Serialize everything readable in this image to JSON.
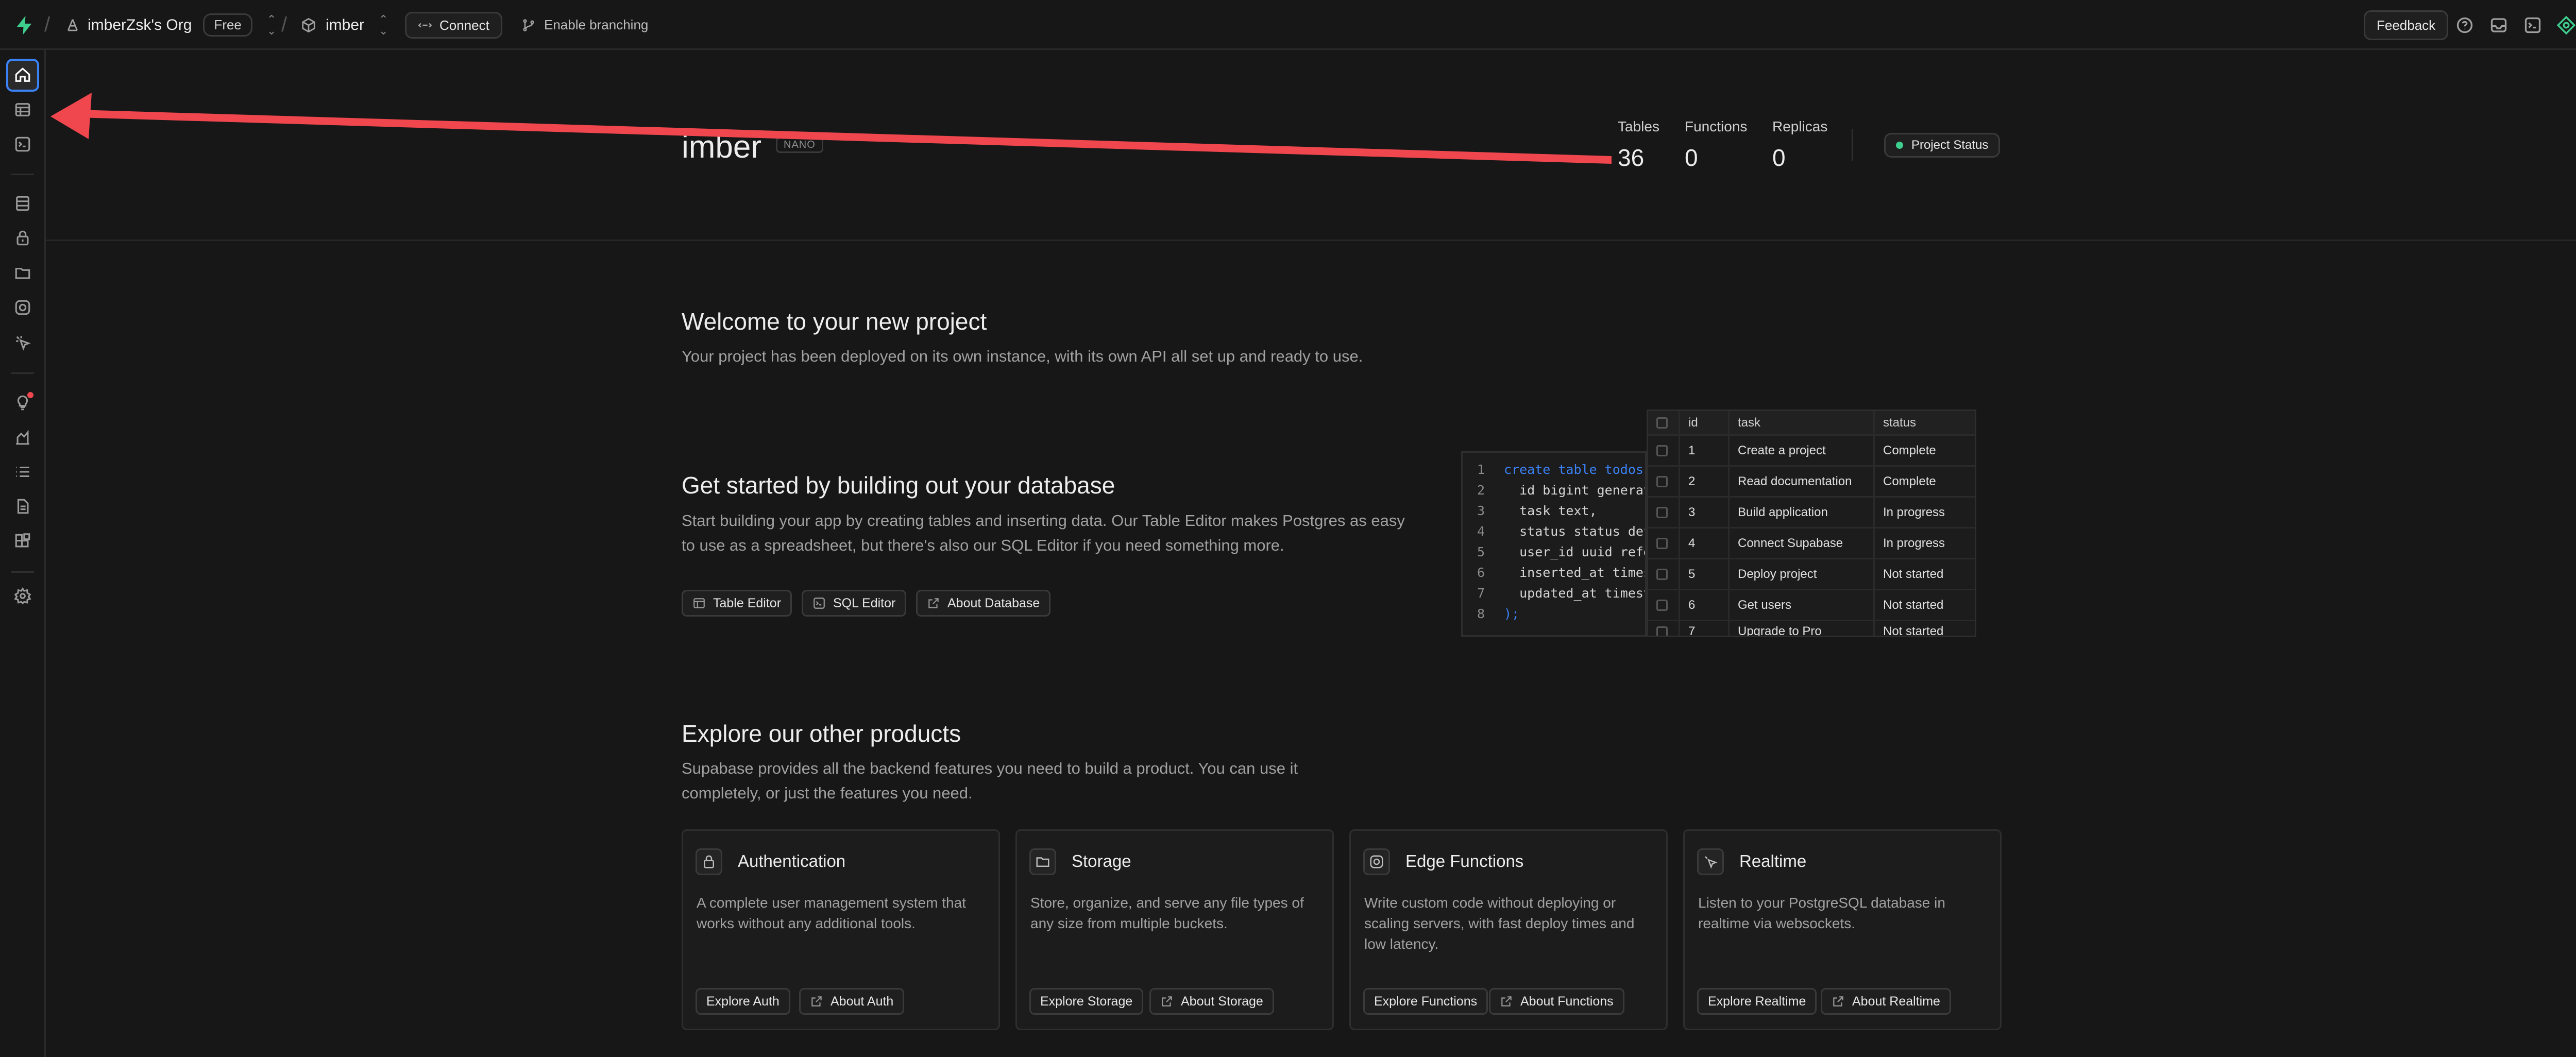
{
  "topbar": {
    "org_name": "imberZsk's Org",
    "plan_badge": "Free",
    "project_name": "imber",
    "connect_label": "Connect",
    "branching_label": "Enable branching",
    "feedback_label": "Feedback"
  },
  "project": {
    "name": "imber",
    "compute_badge": "NANO",
    "stats": [
      {
        "label": "Tables",
        "value": "36"
      },
      {
        "label": "Functions",
        "value": "0"
      },
      {
        "label": "Replicas",
        "value": "0"
      }
    ],
    "status_label": "Project Status",
    "status_color": "#3ecf8e"
  },
  "welcome": {
    "title": "Welcome to your new project",
    "text": "Your project has been deployed on its own instance, with its own API all set up and ready to use."
  },
  "database": {
    "title": "Get started by building out your database",
    "text_line1": "Start building your app by creating tables and inserting data. Our Table Editor makes Postgres as easy",
    "text_line2": "to use as a spreadsheet, but there's also our SQL Editor if you need something more.",
    "buttons": [
      "Table Editor",
      "SQL Editor",
      "About Database"
    ]
  },
  "code_sample": {
    "lines": [
      {
        "num": "1",
        "text": "create table todos"
      },
      {
        "num": "2",
        "text": "  id bigint generat"
      },
      {
        "num": "3",
        "text": "  task text,"
      },
      {
        "num": "4",
        "text": "  status status def"
      },
      {
        "num": "5",
        "text": "  user_id uuid refe"
      },
      {
        "num": "6",
        "text": "  inserted_at times"
      },
      {
        "num": "7",
        "text": "  updated_at timest"
      },
      {
        "num": "8",
        "text": ");"
      }
    ]
  },
  "todo_table": {
    "columns": [
      "id",
      "task",
      "status"
    ],
    "rows": [
      [
        "1",
        "Create a project",
        "Complete"
      ],
      [
        "2",
        "Read documentation",
        "Complete"
      ],
      [
        "3",
        "Build application",
        "In progress"
      ],
      [
        "4",
        "Connect Supabase",
        "In progress"
      ],
      [
        "5",
        "Deploy project",
        "Not started"
      ],
      [
        "6",
        "Get users",
        "Not started"
      ],
      [
        "7",
        "Upgrade to Pro",
        "Not started"
      ]
    ]
  },
  "products": {
    "title": "Explore our other products",
    "text_line1": "Supabase provides all the backend features you need to build a product. You can use it",
    "text_line2": "completely, or just the features you need.",
    "cards": [
      {
        "title": "Authentication",
        "desc_l1": "A complete user management system that",
        "desc_l2": "works without any additional tools.",
        "desc_l3": "",
        "btn1": "Explore Auth",
        "btn2": "About Auth"
      },
      {
        "title": "Storage",
        "desc_l1": "Store, organize, and serve any file types of",
        "desc_l2": "any size from multiple buckets.",
        "desc_l3": "",
        "btn1": "Explore Storage",
        "btn2": "About Storage"
      },
      {
        "title": "Edge Functions",
        "desc_l1": "Write custom code without deploying or",
        "desc_l2": "scaling servers, with fast deploy times and",
        "desc_l3": "low latency.",
        "btn1": "Explore Functions",
        "btn2": "About Functions"
      },
      {
        "title": "Realtime",
        "desc_l1": "Listen to your PostgreSQL database in",
        "desc_l2": "realtime via websockets.",
        "desc_l3": "",
        "btn1": "Explore Realtime",
        "btn2": "About Realtime"
      }
    ]
  },
  "colors": {
    "brand": "#3ecf8e",
    "annotation_arrow": "#f0474f",
    "active_nav": "#3b82f6"
  }
}
